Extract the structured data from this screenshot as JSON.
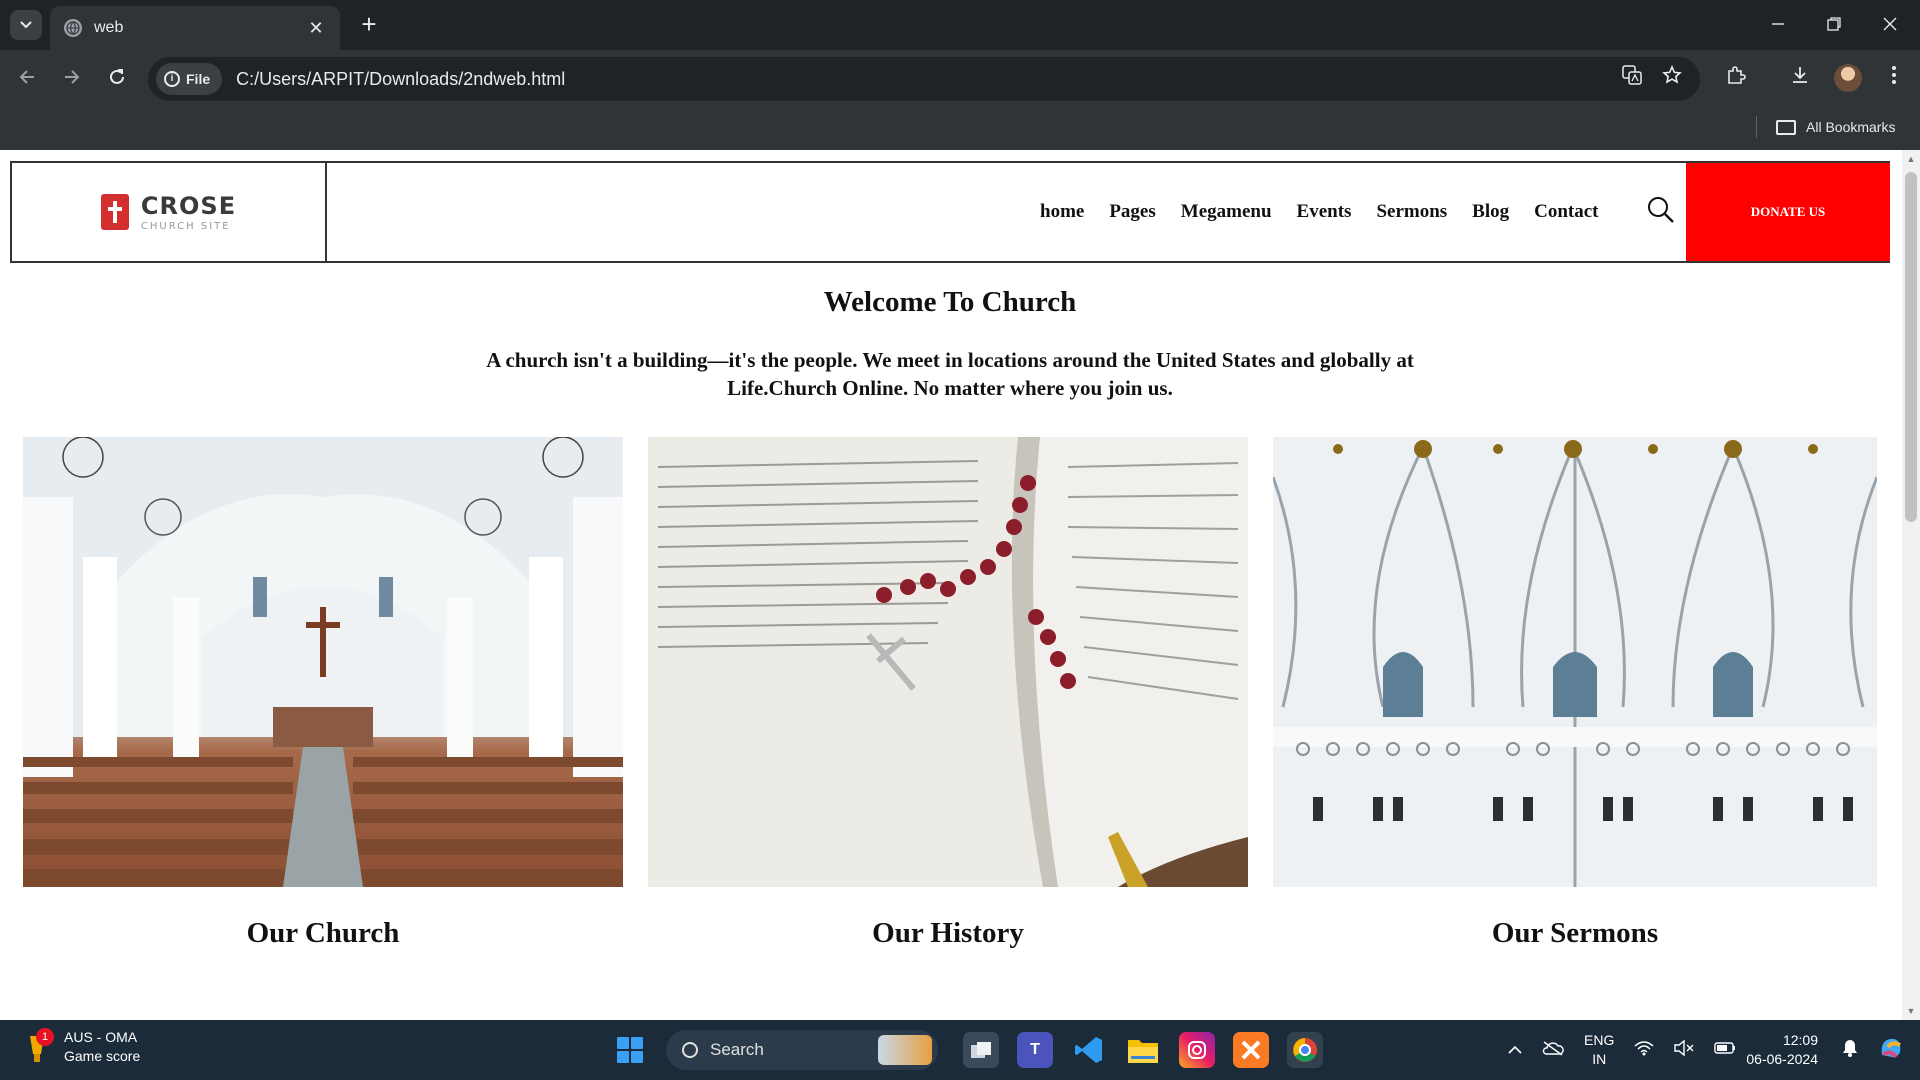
{
  "browser": {
    "tab_title": "web",
    "new_tab_symbol": "+",
    "close_symbol": "✕",
    "site_chip_label": "File",
    "url": "C:/Users/ARPIT/Downloads/2ndweb.html",
    "bookmarks_label": "All Bookmarks"
  },
  "site": {
    "logo_name": "CROSE",
    "logo_sub": "CHURCH SITE",
    "nav": [
      "home",
      "Pages",
      "Megamenu",
      "Events",
      "Sermons",
      "Blog",
      "Contact"
    ],
    "donate_label": "DONATE US",
    "welcome_title": "Welcome To Church",
    "welcome_text": "A church isn't a building—it's the people. We meet in locations around the United States and globally at Life.Church Online. No matter where you join us.",
    "cards": [
      {
        "caption": "Our Church"
      },
      {
        "caption": "Our History"
      },
      {
        "caption": "Our Sermons"
      }
    ],
    "colors": {
      "donate": "#ff0000",
      "logo": "#d32f2f"
    }
  },
  "taskbar": {
    "widget_badge": "1",
    "widget_title": "AUS - OMA",
    "widget_sub": "Game score",
    "search_label": "Search",
    "lang_top": "ENG",
    "lang_bottom": "IN",
    "time": "12:09",
    "date": "06-06-2024"
  }
}
